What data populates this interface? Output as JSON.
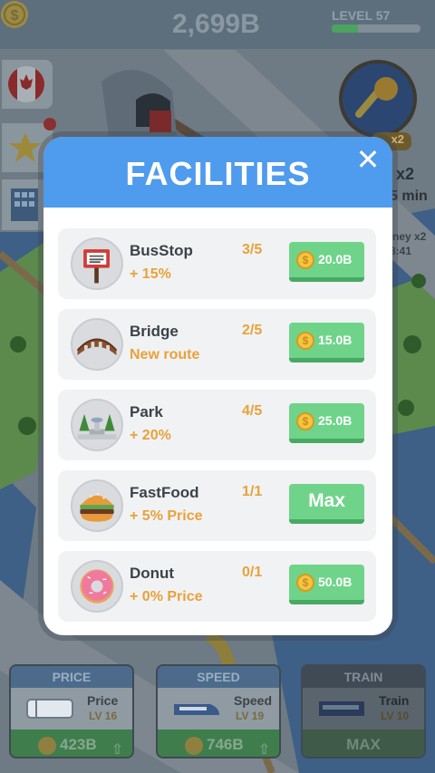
{
  "topbar": {
    "money": "2,699B",
    "level": "LEVEL 57",
    "level_progress": 0.3
  },
  "background": {
    "bonus_badge": "x2",
    "boost_multiplier": "x2",
    "boost_duration": "5 min",
    "money_multiplier": "ney x2",
    "timer": "3:41"
  },
  "modal": {
    "title": "FACILITIES",
    "close_glyph": "✕",
    "items": [
      {
        "name": "BusStop",
        "desc": "+ 15%",
        "count": "3/5",
        "button": "20.0B",
        "icon": "bus-stop-sign-icon"
      },
      {
        "name": "Bridge",
        "desc": "New route",
        "count": "2/5",
        "button": "15.0B",
        "icon": "bridge-icon"
      },
      {
        "name": "Park",
        "desc": "+ 20%",
        "count": "4/5",
        "button": "25.0B",
        "icon": "park-fountain-icon"
      },
      {
        "name": "FastFood",
        "desc": "+ 5% Price",
        "count": "1/1",
        "button": "Max",
        "icon": "burger-icon"
      },
      {
        "name": "Donut",
        "desc": "+ 0% Price",
        "count": "0/1",
        "button": "50.0B",
        "icon": "donut-icon"
      }
    ]
  },
  "bottom_panels": [
    {
      "header": "PRICE",
      "name": "Price",
      "level": "LV 16",
      "cost": "423B",
      "arrow": "⇧"
    },
    {
      "header": "SPEED",
      "name": "Speed",
      "level": "LV 19",
      "cost": "746B",
      "arrow": "⇧"
    },
    {
      "header": "TRAIN",
      "name": "Train",
      "level": "LV 10",
      "cost": "MAX"
    }
  ],
  "colors": {
    "header_blue": "#4f9bee",
    "buy_green": "#6fd48a",
    "accent_orange": "#e8a23a"
  }
}
